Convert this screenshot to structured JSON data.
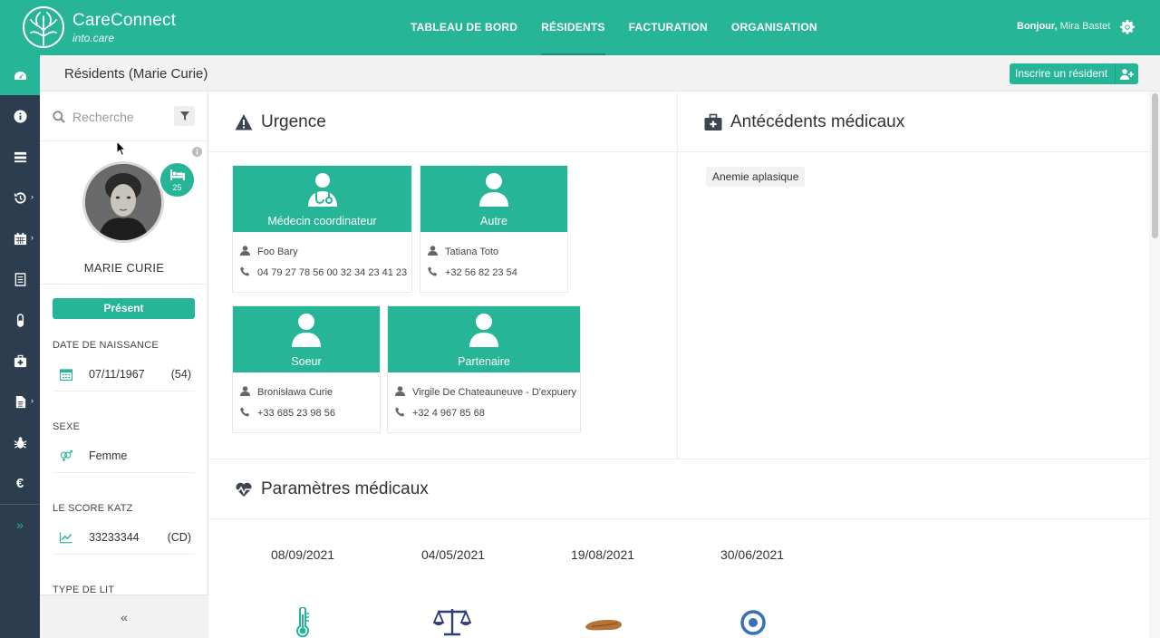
{
  "app": {
    "name": "CareConnect",
    "subtitle": "into.care"
  },
  "nav": {
    "items": [
      {
        "label": "TABLEAU DE BORD",
        "active": false
      },
      {
        "label": "RÉSIDENTS",
        "active": true
      },
      {
        "label": "FACTURATION",
        "active": false
      },
      {
        "label": "ORGANISATION",
        "active": false
      }
    ]
  },
  "user": {
    "greeting": "Bonjour,",
    "name": "Mira Bastet"
  },
  "page": {
    "title": "Résidents (Marie Curie)",
    "enroll_label": "Inscrire un résident"
  },
  "sidebar": {
    "search_placeholder": "Recherche",
    "bed_number": "25",
    "resident_name": "MARIE CURIE",
    "status": "Présent",
    "fields": [
      {
        "label": "DATE DE NAISSANCE",
        "value": "07/11/1967",
        "extra": "(54)",
        "icon": "calendar-icon"
      },
      {
        "label": "SEXE",
        "value": "Femme",
        "extra": "",
        "icon": "gender-icon"
      },
      {
        "label": "LE SCORE KATZ",
        "value": "33233344",
        "extra": "(CD)",
        "icon": "chart-line-icon"
      },
      {
        "label": "TYPE DE LIT",
        "value": "",
        "extra": "",
        "icon": ""
      }
    ],
    "collapse_label": "«"
  },
  "urgence": {
    "title": "Urgence",
    "contacts": [
      {
        "role": "Médecin coordinateur",
        "name": "Foo Bary",
        "phone": "04 79 27 78 56 00 32 34 23 41 23",
        "icon": "doctor-icon"
      },
      {
        "role": "Autre",
        "name": "Tatiana Toto",
        "phone": "+32 56 82 23 54",
        "icon": "user-icon"
      },
      {
        "role": "Soeur",
        "name": "Bronisława Curie",
        "phone": "+33 685 23 98 56",
        "icon": "user-icon"
      },
      {
        "role": "Partenaire",
        "name": "Virgile De Chateauneuve - D'expuery",
        "phone": "+32 4 967 85 68",
        "icon": "user-icon"
      }
    ]
  },
  "antecedents": {
    "title": "Antécédents médicaux",
    "tags": [
      "Anemie aplasique"
    ]
  },
  "parametres": {
    "title": "Paramètres médicaux",
    "dates": [
      "08/09/2021",
      "04/05/2021",
      "19/08/2021",
      "30/06/2021"
    ],
    "icons": [
      "thermometer-icon",
      "scale-icon",
      "stool-icon",
      "target-icon"
    ]
  },
  "colors": {
    "accent": "#26b597",
    "rail": "#2b3d4f"
  }
}
